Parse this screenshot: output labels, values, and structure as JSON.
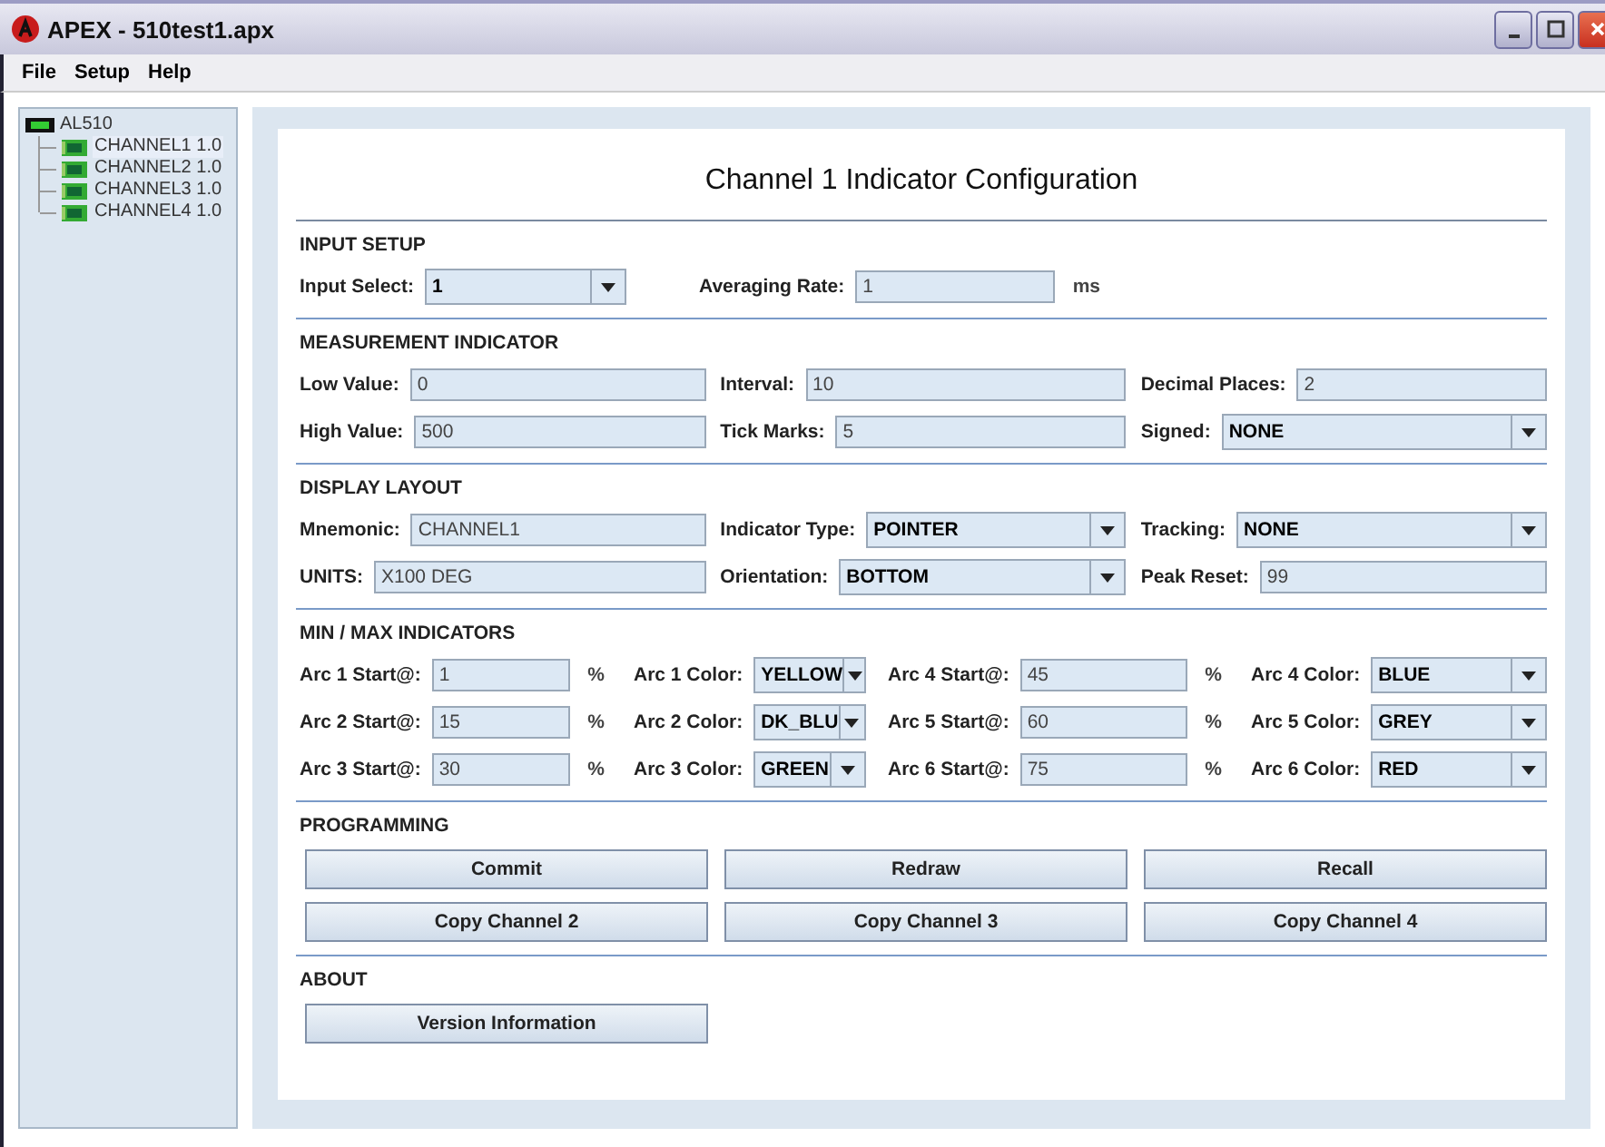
{
  "window": {
    "title": "APEX - 510test1.apx"
  },
  "menu": [
    "File",
    "Setup",
    "Help"
  ],
  "tree": {
    "label": "AL510",
    "children": [
      {
        "label": "CHANNEL1 1.0",
        "selected": true
      },
      {
        "label": "CHANNEL2 1.0",
        "selected": false
      },
      {
        "label": "CHANNEL3 1.0",
        "selected": false
      },
      {
        "label": "CHANNEL4 1.0",
        "selected": false
      }
    ]
  },
  "heading": "Channel 1 Indicator Configuration",
  "sections": [
    {
      "title": "INPUT SETUP",
      "kind": "inline",
      "rows": [
        [
          {
            "kind": "combo",
            "label": "Input Select:",
            "value": "1"
          },
          {
            "kind": "text",
            "label": "Averaging Rate:",
            "value": "1",
            "suffix": "ms"
          }
        ]
      ]
    },
    {
      "title": "MEASUREMENT INDICATOR",
      "kind": "three",
      "rows": [
        [
          {
            "kind": "text",
            "label": "Low Value:",
            "value": "0"
          },
          {
            "kind": "text",
            "label": "Interval:",
            "value": "10"
          },
          {
            "kind": "text",
            "label": "Decimal Places:",
            "value": "2"
          }
        ],
        [
          {
            "kind": "text",
            "label": "High Value:",
            "value": "500"
          },
          {
            "kind": "text",
            "label": "Tick Marks:",
            "value": "5"
          },
          {
            "kind": "combo",
            "label": "Signed:",
            "value": "NONE"
          }
        ]
      ]
    },
    {
      "title": "DISPLAY LAYOUT",
      "kind": "three",
      "rows": [
        [
          {
            "kind": "text",
            "label": "Mnemonic:",
            "value": "CHANNEL1"
          },
          {
            "kind": "combo",
            "label": "Indicator Type:",
            "value": "POINTER"
          },
          {
            "kind": "combo",
            "label": "Tracking:",
            "value": "NONE"
          }
        ],
        [
          {
            "kind": "text",
            "label": "UNITS:",
            "value": "X100 DEG"
          },
          {
            "kind": "combo",
            "label": "Orientation:",
            "value": "BOTTOM"
          },
          {
            "kind": "text",
            "label": "Peak Reset:",
            "value": "99"
          }
        ]
      ]
    },
    {
      "title": "MIN / MAX INDICATORS",
      "kind": "four",
      "rows": [
        [
          {
            "kind": "text",
            "label": "Arc 1 Start@:",
            "value": "1",
            "suffix": "%"
          },
          {
            "kind": "combo",
            "label": "Arc 1 Color:",
            "value": "YELLOW"
          },
          {
            "kind": "text",
            "label": "Arc 4 Start@:",
            "value": "45",
            "suffix": "%"
          },
          {
            "kind": "combo",
            "label": "Arc 4 Color:",
            "value": "BLUE"
          }
        ],
        [
          {
            "kind": "text",
            "label": "Arc 2 Start@:",
            "value": "15",
            "suffix": "%"
          },
          {
            "kind": "combo",
            "label": "Arc 2 Color:",
            "value": "DK_BLU"
          },
          {
            "kind": "text",
            "label": "Arc 5 Start@:",
            "value": "60",
            "suffix": "%"
          },
          {
            "kind": "combo",
            "label": "Arc 5 Color:",
            "value": "GREY"
          }
        ],
        [
          {
            "kind": "text",
            "label": "Arc 3 Start@:",
            "value": "30",
            "suffix": "%"
          },
          {
            "kind": "combo",
            "label": "Arc 3 Color:",
            "value": "GREEN"
          },
          {
            "kind": "text",
            "label": "Arc 6 Start@:",
            "value": "75",
            "suffix": "%"
          },
          {
            "kind": "combo",
            "label": "Arc 6 Color:",
            "value": "RED"
          }
        ]
      ]
    },
    {
      "title": "PROGRAMMING",
      "kind": "buttons",
      "buttons": [
        "Commit",
        "Redraw",
        "Recall",
        "Copy Channel 2",
        "Copy Channel 3",
        "Copy Channel 4"
      ]
    },
    {
      "title": "ABOUT",
      "kind": "buttons",
      "buttons": [
        "Version Information"
      ]
    }
  ]
}
